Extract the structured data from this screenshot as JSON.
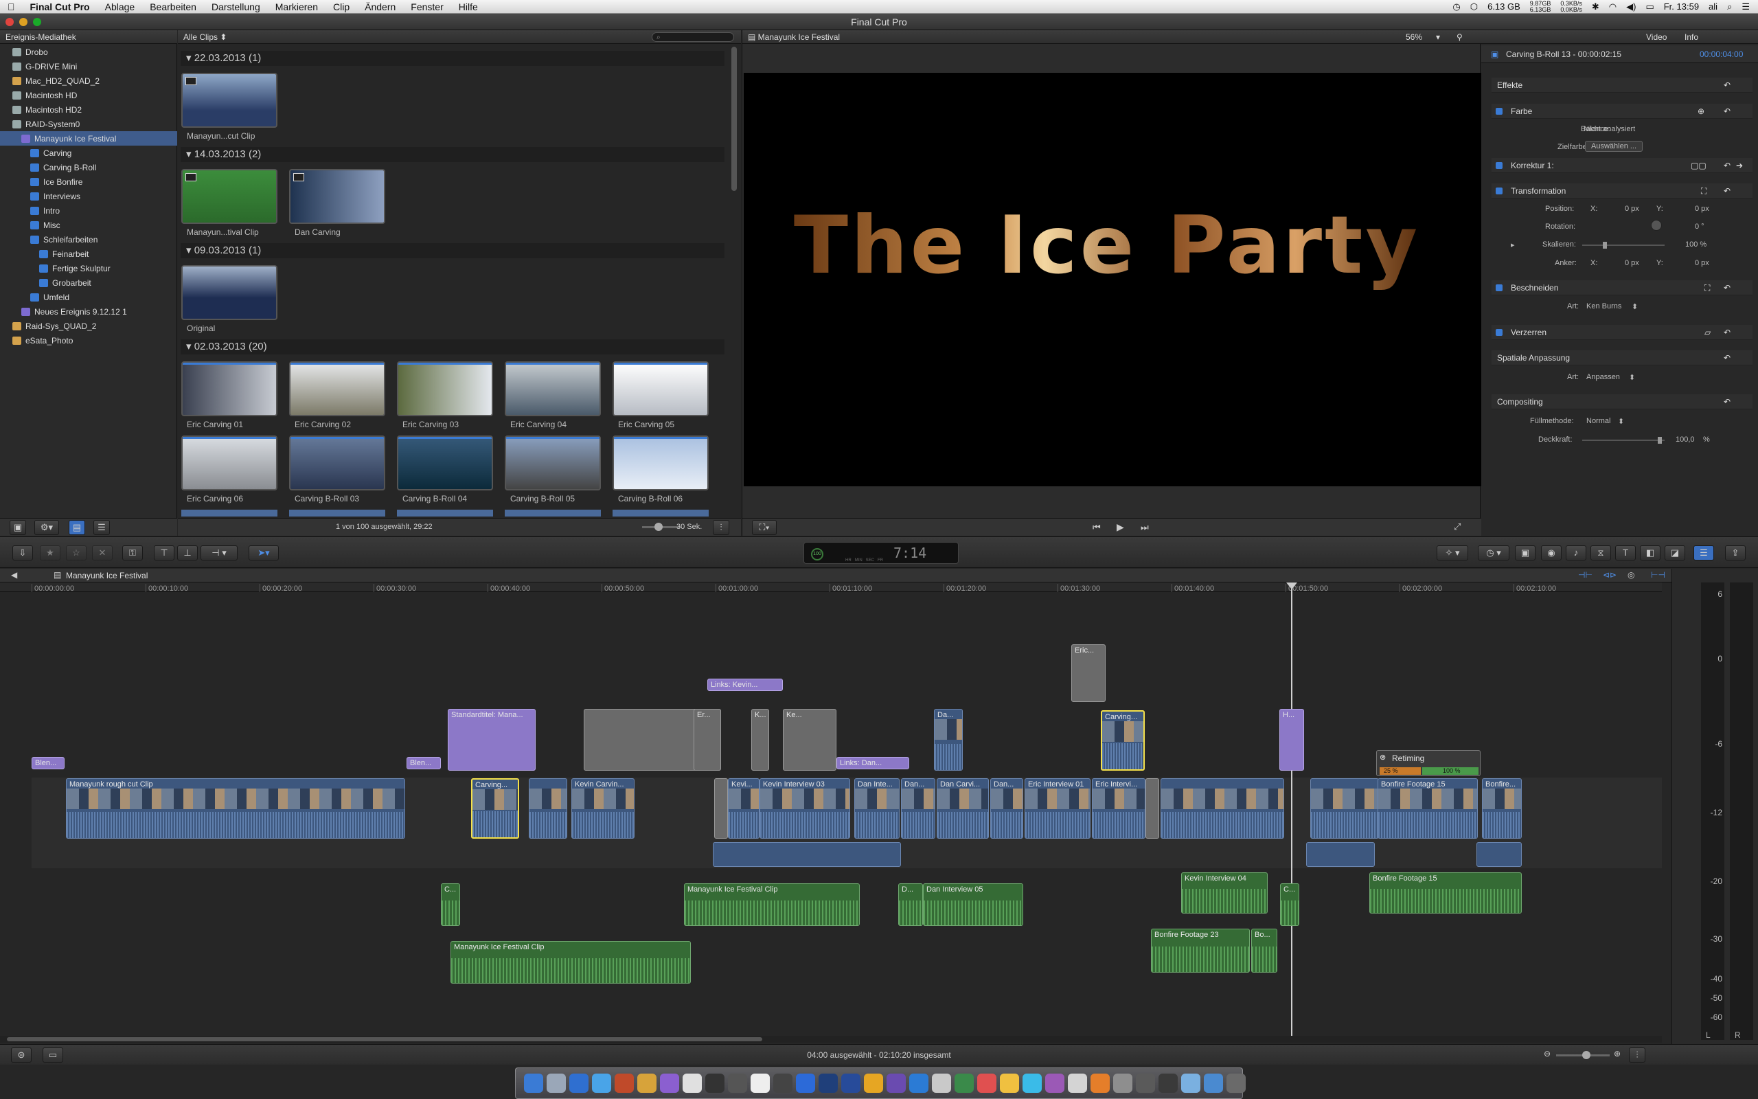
{
  "menubar": {
    "apple": "",
    "app": "Final Cut Pro",
    "items": [
      "Ablage",
      "Bearbeiten",
      "Darstellung",
      "Markieren",
      "Clip",
      "Ändern",
      "Fenster",
      "Hilfe"
    ],
    "status": {
      "disk": "6.13 GB",
      "mem_top": "9.87GB",
      "mem_bot": "6.13GB",
      "net_top": "0.3KB/s",
      "net_bot": "0.0KB/s",
      "clock": "Fr. 13:59",
      "user": "ali"
    }
  },
  "window": {
    "title": "Final Cut Pro"
  },
  "library": {
    "header": "Ereignis-Mediathek",
    "items": [
      {
        "label": "Drobo",
        "indent": 0,
        "kind": "drive"
      },
      {
        "label": "G-DRIVE Mini",
        "indent": 0,
        "kind": "drive"
      },
      {
        "label": "Mac_HD2_QUAD_2",
        "indent": 0,
        "kind": "hd"
      },
      {
        "label": "Macintosh HD",
        "indent": 0,
        "kind": "drive"
      },
      {
        "label": "Macintosh HD2",
        "indent": 0,
        "kind": "drive"
      },
      {
        "label": "RAID-System0",
        "indent": 0,
        "kind": "drive"
      },
      {
        "label": "Manayunk Ice Festival",
        "indent": 1,
        "kind": "event",
        "selected": true
      },
      {
        "label": "Carving",
        "indent": 2,
        "kind": "keyword"
      },
      {
        "label": "Carving B-Roll",
        "indent": 2,
        "kind": "keyword"
      },
      {
        "label": "Ice Bonfire",
        "indent": 2,
        "kind": "keyword"
      },
      {
        "label": "Interviews",
        "indent": 2,
        "kind": "keyword"
      },
      {
        "label": "Intro",
        "indent": 2,
        "kind": "keyword"
      },
      {
        "label": "Misc",
        "indent": 2,
        "kind": "keyword"
      },
      {
        "label": "Schleifarbeiten",
        "indent": 2,
        "kind": "folder"
      },
      {
        "label": "Feinarbeit",
        "indent": 3,
        "kind": "keyword"
      },
      {
        "label": "Fertige Skulptur",
        "indent": 3,
        "kind": "keyword"
      },
      {
        "label": "Grobarbeit",
        "indent": 3,
        "kind": "keyword"
      },
      {
        "label": "Umfeld",
        "indent": 2,
        "kind": "keyword"
      },
      {
        "label": "Neues Ereignis 9.12.12 1",
        "indent": 1,
        "kind": "event"
      },
      {
        "label": "Raid-Sys_QUAD_2",
        "indent": 0,
        "kind": "hd"
      },
      {
        "label": "eSata_Photo",
        "indent": 0,
        "kind": "hd"
      }
    ]
  },
  "browser": {
    "filter": "Alle Clips",
    "groups": [
      {
        "title": "22.03.2013  (1)",
        "clips": [
          "Manayun...cut Clip"
        ]
      },
      {
        "title": "14.03.2013  (2)",
        "clips": [
          "Manayun...tival Clip",
          "Dan Carving"
        ]
      },
      {
        "title": "09.03.2013  (1)",
        "clips": [
          "Original"
        ]
      },
      {
        "title": "02.03.2013  (20)",
        "clips": [
          "Eric Carving 01",
          "Eric Carving 02",
          "Eric Carving 03",
          "Eric Carving 04",
          "Eric Carving 05",
          "Eric Carving 06",
          "Carving B-Roll 03",
          "Carving B-Roll 04",
          "Carving B-Roll 05",
          "Carving B-Roll 06"
        ]
      }
    ],
    "status": "1 von 100 ausgewählt, 29:22",
    "duration": "30 Sek."
  },
  "viewer": {
    "title": "Manayunk Ice Festival",
    "zoom": "56%",
    "overlay_text": "The Ice Party"
  },
  "inspector": {
    "tabs": [
      "Video",
      "Info"
    ],
    "clip_name": "Carving B-Roll 13 - 00:00:02:15",
    "clip_time": "00:00:04:00",
    "effects_label": "Effekte",
    "farbe": "Farbe",
    "balance_label": "Balance:",
    "balance_value": "Nicht analysiert",
    "zielfarbe_label": "Zielfarbe:",
    "zielfarbe_button": "Auswählen ...",
    "korrektur": "Korrektur 1:",
    "transformation": "Transformation",
    "position_label": "Position:",
    "pos_x_label": "X:",
    "pos_x": "0 px",
    "pos_y_label": "Y:",
    "pos_y": "0 px",
    "rotation_label": "Rotation:",
    "rotation": "0 °",
    "skalieren_label": "Skalieren:",
    "skalieren": "100 %",
    "anker_label": "Anker:",
    "anker_x_label": "X:",
    "anker_x": "0 px",
    "anker_y_label": "Y:",
    "anker_y": "0 px",
    "beschneiden": "Beschneiden",
    "art_label": "Art:",
    "art_value": "Ken Burns",
    "verzerren": "Verzerren",
    "spatial": "Spatiale Anpassung",
    "spatial_art_label": "Art:",
    "spatial_art": "Anpassen",
    "compositing": "Compositing",
    "fuell_label": "Füllmethode:",
    "fuell_value": "Normal",
    "deck_label": "Deckkraft:",
    "deck_value": "100,0",
    "deck_unit": "%"
  },
  "toolbar": {
    "timecode": "7:14",
    "timecode_dim": "00:00:0",
    "tc_prefix": "100",
    "tc_sub": "HR   MIN   SEC   FR"
  },
  "timeline": {
    "project": "Manayunk Ice Festival",
    "ticks": [
      "00:00:00:00",
      "00:00:10:00",
      "00:00:20:00",
      "00:00:30:00",
      "00:00:40:00",
      "00:00:50:00",
      "00:01:00:00",
      "00:01:10:00",
      "00:01:20:00",
      "00:01:30:00",
      "00:01:40:00",
      "00:01:50:00",
      "00:02:00:00",
      "00:02:10:00"
    ],
    "clips": {
      "blend1": "Blen...",
      "blend2": "Blen...",
      "std_title": "Standardtitel: Mana...",
      "links_kevin": "Links: Kevin...",
      "links_dan": "Links: Dan...",
      "eric_top": "Eric...",
      "carving_sel": "Carving...",
      "rough": "Manayunk rough cut Clip",
      "carving1": "Carving...",
      "kevin_carv": "Kevin Carvin...",
      "kevi": "Kevi...",
      "kevin_int03": "Kevin Interview 03",
      "dan_inte": "Dan Inte...",
      "dan1": "Dan...",
      "dan_carvi": "Dan Carvi...",
      "dan2": "Dan...",
      "eric_int01": "Eric Interview 01",
      "eric_intervi": "Eric Intervi...",
      "bonfire15": "Bonfire Footage 15",
      "bonfire_x": "Bonfire...",
      "retiming": "Retiming",
      "ret_25": "25 %",
      "ret_100": "100 %",
      "festival_clip": "Manayunk Ice Festival Clip",
      "d_clip": "D...",
      "dan_int05": "Dan Interview 05",
      "kevin_int04": "Kevin Interview 04",
      "bonfire15_audio": "Bonfire Footage 15",
      "festival_clip2": "Manayunk Ice Festival Clip",
      "bonfire23": "Bonfire Footage 23",
      "bo": "Bo...",
      "c_a": "C...",
      "c_b": "C...",
      "ka": "K...",
      "ke": "Ke...",
      "da": "Da...",
      "h": "H...",
      "er": "Er..."
    },
    "status": "04:00 ausgewählt - 02:10:20 insgesamt"
  },
  "meter": {
    "labels": [
      "6",
      "0",
      "-6",
      "-12",
      "-20",
      "-30",
      "-40",
      "-50",
      "-60"
    ],
    "channels": [
      "L",
      "R"
    ]
  },
  "colors": {
    "accent": "#3a7bd5",
    "video_clip": "#3d577e",
    "audio_clip": "#356b35",
    "title_clip": "#8c78c8",
    "selection": "#f5e14a"
  }
}
